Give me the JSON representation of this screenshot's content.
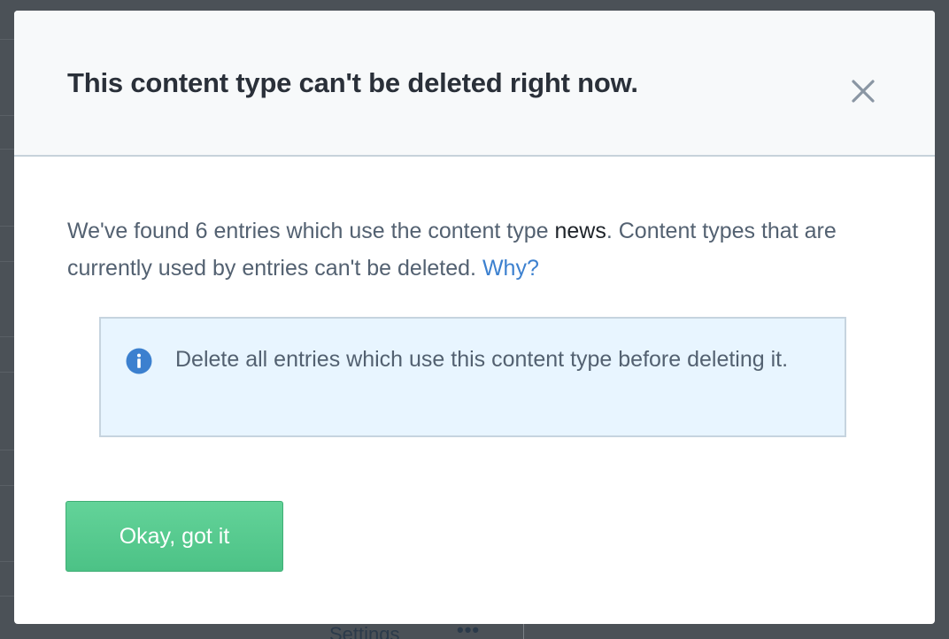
{
  "background": {
    "settings_label": "Settings",
    "more_label": "•••"
  },
  "modal": {
    "title": "This content type can't be deleted right now.",
    "close_icon": "close-icon",
    "message": {
      "prefix": "We've found 6 entries which use the content type ",
      "content_type": "news",
      "suffix": ". Content types that are currently used by entries can't be deleted. ",
      "link": "Why?"
    },
    "note": {
      "icon": "info-icon",
      "text": "Delete all entries which use this content type before deleting it."
    },
    "confirm_button": "Okay, got it"
  },
  "colors": {
    "overlay": "#4b5157",
    "header_bg": "#f7f9fa",
    "link": "#3c80cf",
    "note_bg": "#e8f5ff",
    "info_icon": "#3c80cf",
    "button": "#55c98d"
  }
}
